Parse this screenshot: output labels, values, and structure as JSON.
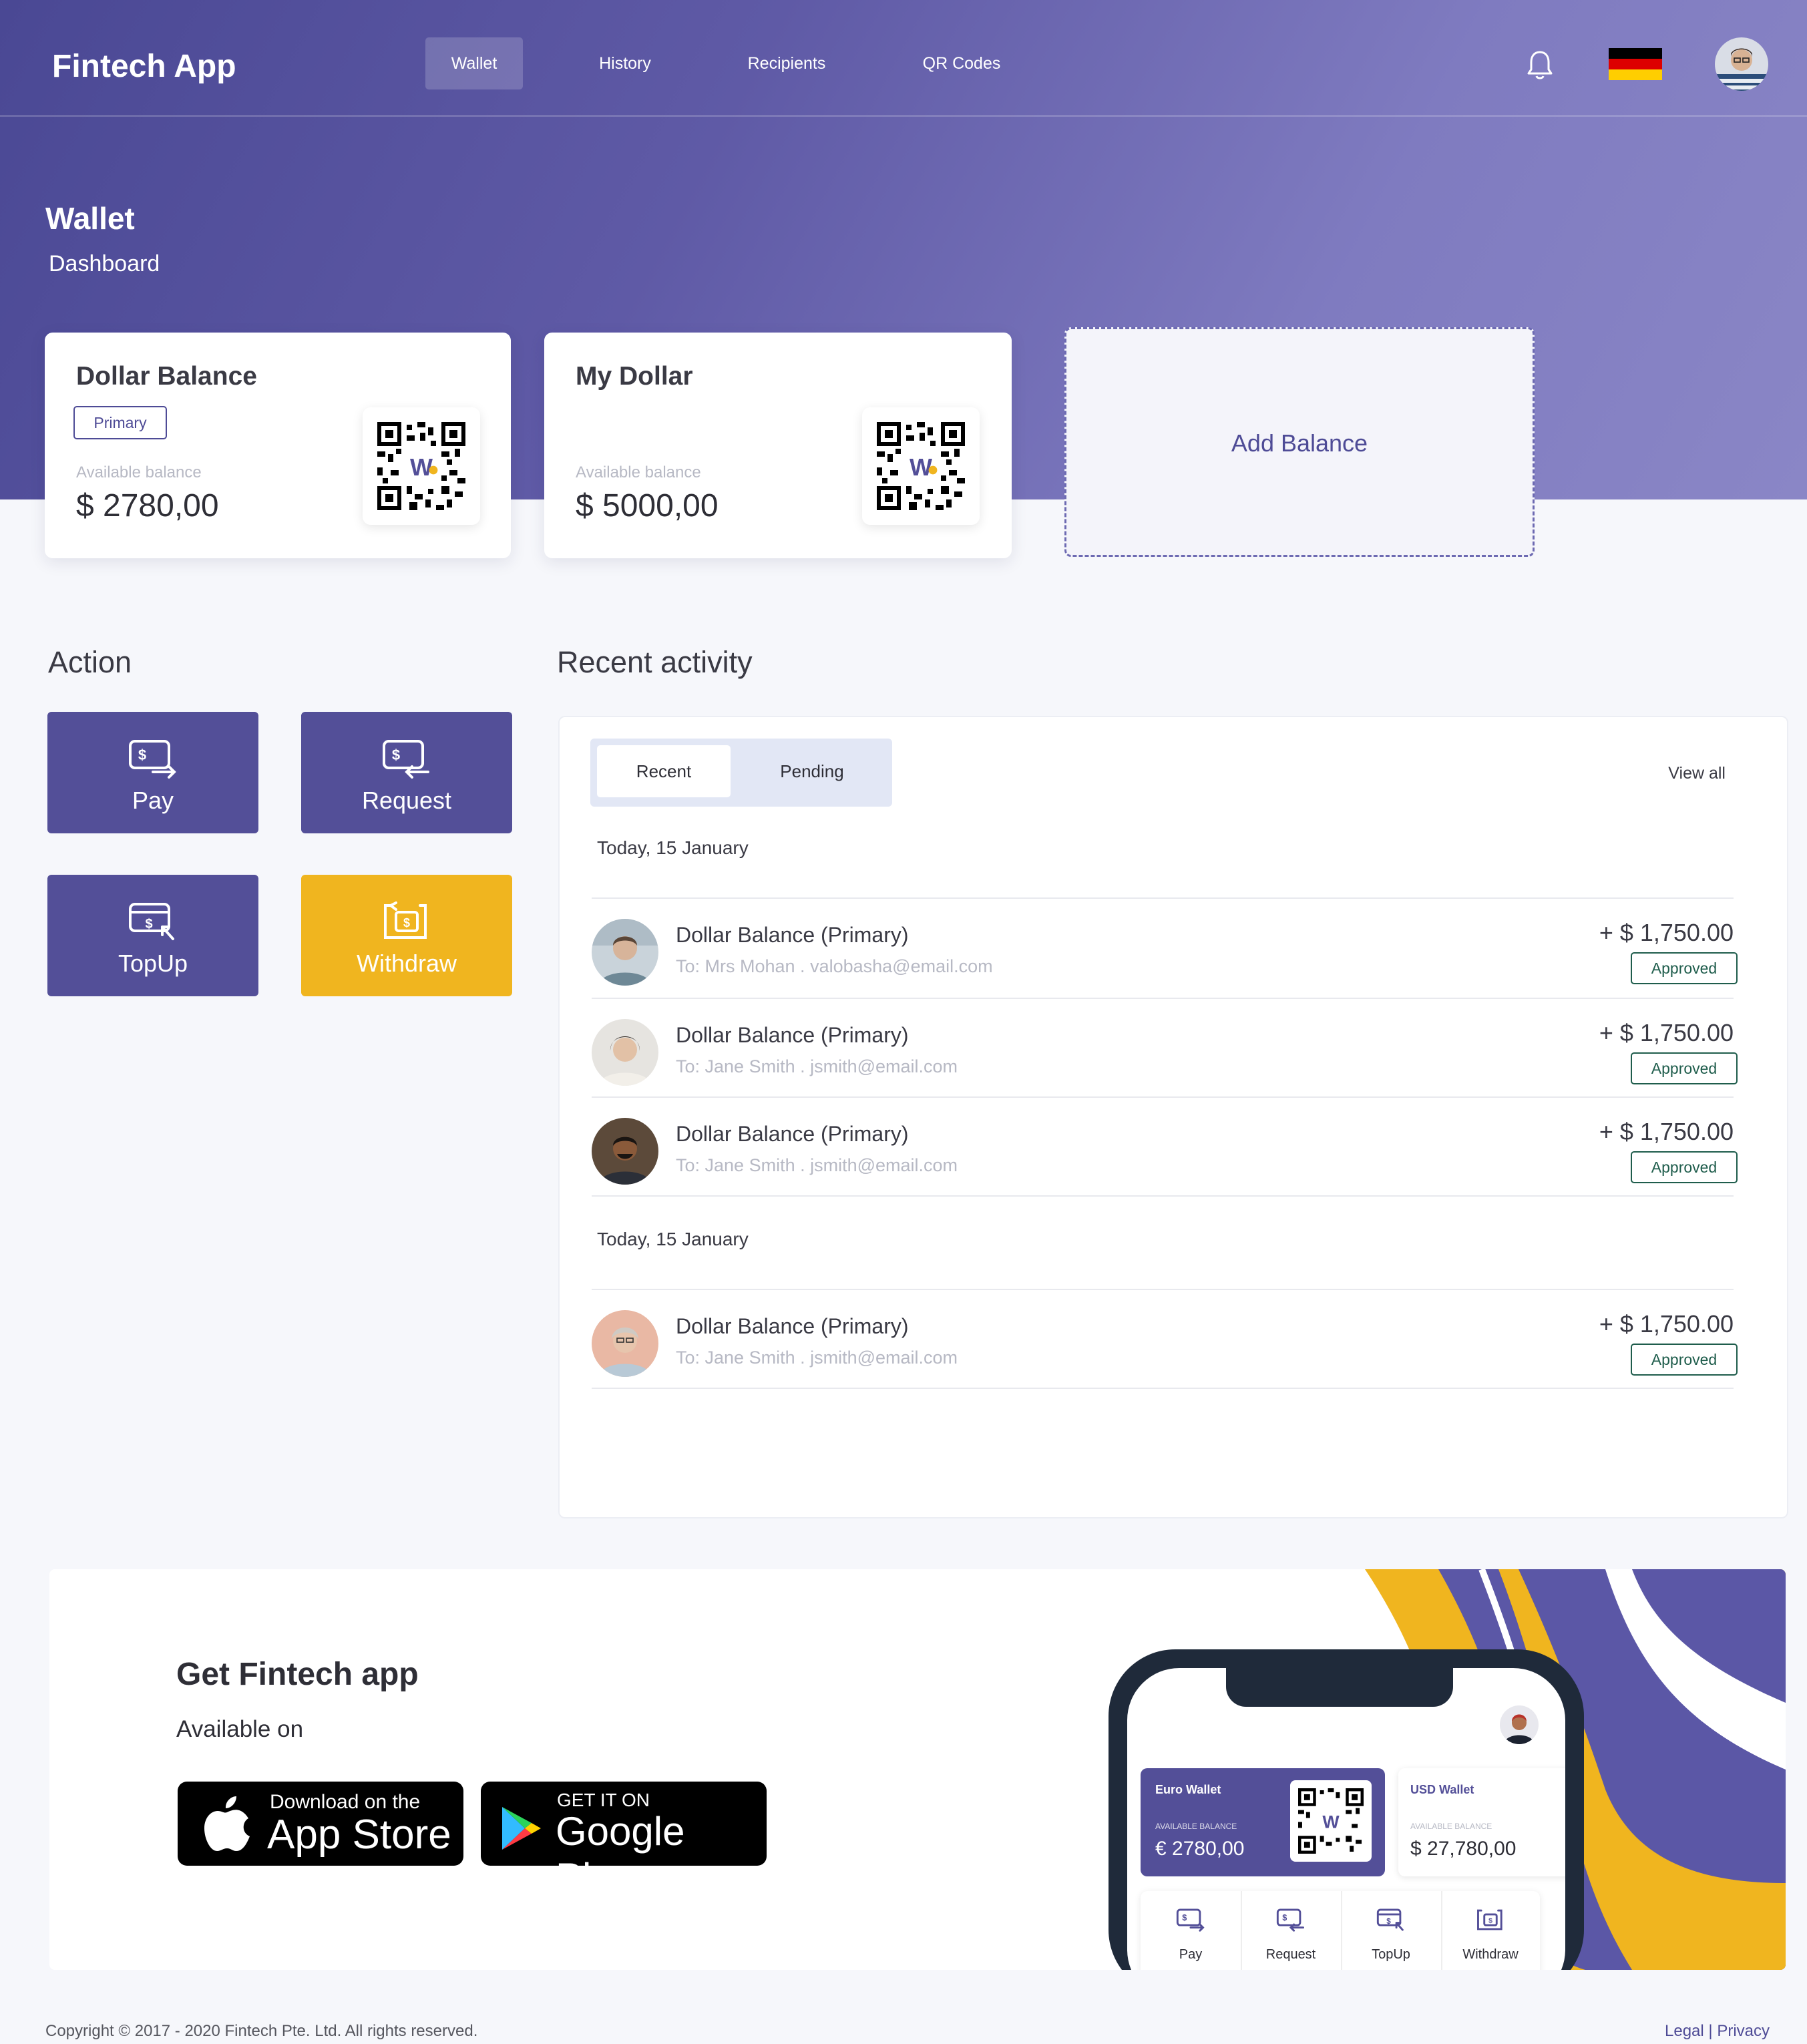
{
  "brand": "Fintech App",
  "nav": {
    "items": [
      {
        "label": "Wallet",
        "active": true
      },
      {
        "label": "History",
        "active": false
      },
      {
        "label": "Recipients",
        "active": false
      },
      {
        "label": "QR Codes",
        "active": false
      }
    ],
    "icons": [
      "bell-icon",
      "germany-flag-icon",
      "user-avatar"
    ]
  },
  "page": {
    "title": "Wallet",
    "subtitle": "Dashboard"
  },
  "cards": [
    {
      "title": "Dollar Balance",
      "badge": "Primary",
      "available_label": "Available balance",
      "amount": "$ 2780,00"
    },
    {
      "title": "My Dollar",
      "available_label": "Available balance",
      "amount": "$ 5000,00"
    }
  ],
  "add_balance_label": "Add Balance",
  "actions": {
    "title": "Action",
    "buttons": [
      {
        "label": "Pay",
        "icon": "pay-icon"
      },
      {
        "label": "Request",
        "icon": "request-icon"
      },
      {
        "label": "TopUp",
        "icon": "topup-icon"
      },
      {
        "label": "Withdraw",
        "icon": "withdraw-icon"
      }
    ]
  },
  "activity": {
    "title": "Recent activity",
    "tabs": [
      {
        "label": "Recent",
        "active": true
      },
      {
        "label": "Pending",
        "active": false
      }
    ],
    "view_all": "View all",
    "groups": [
      {
        "date": "Today, 15 January",
        "items": [
          {
            "name": "Dollar Balance (Primary)",
            "to": "To: Mrs Mohan . valobasha@email.com",
            "amount": "+ $ 1,750.00",
            "status": "Approved"
          },
          {
            "name": "Dollar Balance (Primary)",
            "to": "To: Jane Smith . jsmith@email.com",
            "amount": "+ $ 1,750.00",
            "status": "Approved"
          },
          {
            "name": "Dollar Balance (Primary)",
            "to": "To: Jane Smith . jsmith@email.com",
            "amount": "+ $ 1,750.00",
            "status": "Approved"
          }
        ]
      },
      {
        "date": "Today, 15 January",
        "items": [
          {
            "name": "Dollar Balance (Primary)",
            "to": "To: Jane Smith . jsmith@email.com",
            "amount": "+ $ 1,750.00",
            "status": "Approved"
          }
        ]
      }
    ]
  },
  "promo": {
    "title": "Get Fintech app",
    "subtitle": "Available on",
    "app_store": {
      "small": "Download on the",
      "big": "App Store"
    },
    "google_play": {
      "small": "GET IT ON",
      "big": "Google Play"
    },
    "phone": {
      "euro_wallet": {
        "title": "Euro Wallet",
        "label": "AVAILABLE BALANCE",
        "amount": "€ 2780,00"
      },
      "usd_wallet": {
        "title": "USD Wallet",
        "label": "AVAILABLE BALANCE",
        "amount": "$ 27,780,00"
      },
      "actions": [
        "Pay",
        "Request",
        "TopUp",
        "Withdraw"
      ]
    }
  },
  "footer": {
    "copyright": "Copyright © 2017 - 2020 Fintech Pte. Ltd. All rights reserved.",
    "legal": "Legal",
    "separator": "|",
    "privacy": "Privacy"
  },
  "colors": {
    "primary": "#534f98",
    "accent": "#f0b51f",
    "approved": "#1f5d4c"
  }
}
